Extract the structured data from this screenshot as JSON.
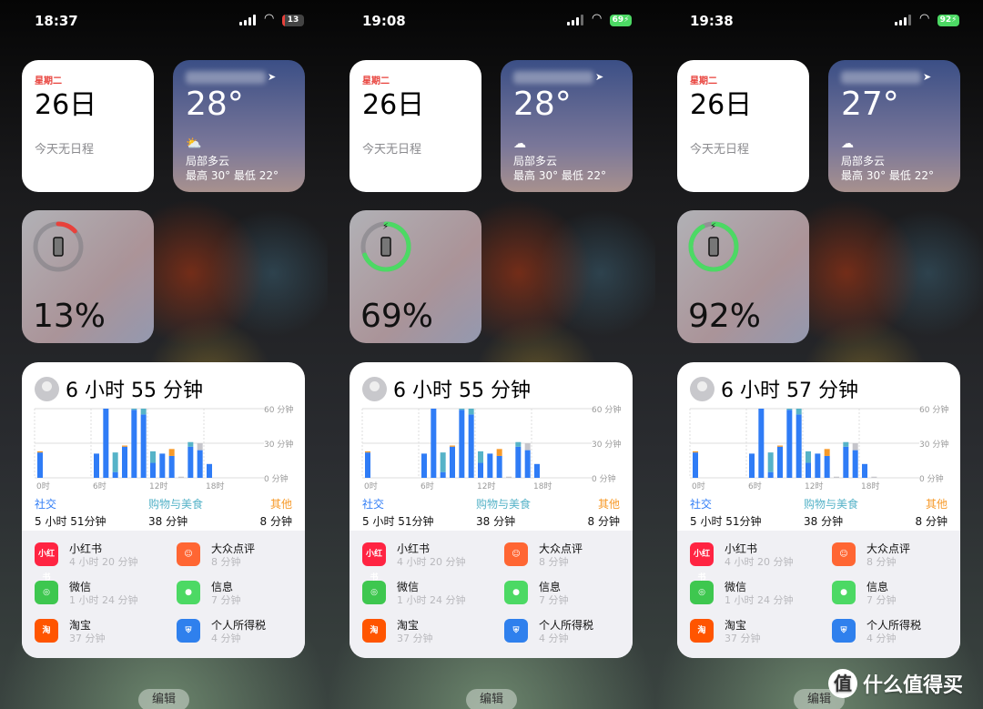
{
  "colors": {
    "social": "#2f7cf6",
    "shopping": "#56b3c8",
    "other": "#f79a2a",
    "gray": "#c5c5cb",
    "battery_low": "#e8413b",
    "battery_charging": "#4cd964"
  },
  "chart_axis": {
    "y_labels": [
      "60 分钟",
      "30 分钟",
      "0 分钟"
    ],
    "x_labels": [
      "0时",
      "6时",
      "12时",
      "18时"
    ],
    "ylim": [
      0,
      60
    ]
  },
  "panels": [
    {
      "status": {
        "time": "18:37",
        "battery": "13",
        "battery_charging": false
      },
      "calendar": {
        "weekday": "星期二",
        "day": "26日",
        "events": "今天无日程"
      },
      "weather": {
        "temp": "28°",
        "condition": "局部多云",
        "hilo": "最高 30° 最低 22°",
        "icon": "partly-sunny-icon"
      },
      "battery_widget": {
        "percent": "13%",
        "level": 0.13,
        "charging": false
      },
      "screen_time": {
        "total": "6 小时 55 分钟",
        "categories": [
          {
            "label": "社交",
            "value": "5 小时 51分钟"
          },
          {
            "label": "购物与美食",
            "value": "38 分钟"
          },
          {
            "label": "其他",
            "value": "8 分钟"
          }
        ],
        "chart_data": {
          "type": "bar",
          "stacked": true,
          "x": [
            0,
            1,
            2,
            3,
            4,
            5,
            6,
            7,
            8,
            9,
            10,
            11,
            12,
            13,
            14,
            15,
            16,
            17,
            18,
            19,
            20,
            21,
            22,
            23
          ],
          "series": [
            {
              "name": "社交",
              "values": [
                22,
                0,
                0,
                0,
                0,
                0,
                21,
                60,
                5,
                27,
                59,
                55,
                13,
                21,
                19,
                0,
                27,
                24,
                12,
                0,
                0,
                0,
                0,
                0
              ]
            },
            {
              "name": "购物与美食",
              "values": [
                0,
                0,
                0,
                0,
                0,
                0,
                0,
                0,
                17,
                0,
                1,
                5,
                10,
                0,
                0,
                0,
                4,
                0,
                0,
                0,
                0,
                0,
                0,
                0
              ]
            },
            {
              "name": "其他",
              "values": [
                1,
                0,
                0,
                0,
                0,
                0,
                0,
                0,
                0,
                1,
                0,
                0,
                0,
                0,
                6,
                0,
                0,
                0,
                0,
                0,
                0,
                0,
                0,
                0
              ]
            },
            {
              "values": [
                0,
                0,
                0,
                0,
                0,
                0,
                0,
                0,
                0,
                0,
                0,
                0,
                0,
                0,
                0,
                1,
                0,
                6,
                0,
                0,
                0,
                0,
                0,
                0
              ]
            }
          ]
        },
        "apps": [
          {
            "name": "小红书",
            "time": "4 小时 20 分钟",
            "icon": "xiaohongshu-icon"
          },
          {
            "name": "大众点评",
            "time": "8 分钟",
            "icon": "dianping-icon"
          },
          {
            "name": "微信",
            "time": "1 小时 24 分钟",
            "icon": "wechat-icon"
          },
          {
            "name": "信息",
            "time": "7 分钟",
            "icon": "messages-icon"
          },
          {
            "name": "淘宝",
            "time": "37 分钟",
            "icon": "taobao-icon"
          },
          {
            "name": "个人所得税",
            "time": "4 分钟",
            "icon": "tax-icon"
          }
        ]
      },
      "edit_label": "编辑"
    },
    {
      "status": {
        "time": "19:08",
        "battery": "69",
        "battery_charging": true
      },
      "calendar": {
        "weekday": "星期二",
        "day": "26日",
        "events": "今天无日程"
      },
      "weather": {
        "temp": "28°",
        "condition": "局部多云",
        "hilo": "最高 30° 最低 22°",
        "icon": "partly-cloudy-night-icon"
      },
      "battery_widget": {
        "percent": "69%",
        "level": 0.69,
        "charging": true
      },
      "screen_time": {
        "total": "6 小时 55 分钟",
        "categories": [
          {
            "label": "社交",
            "value": "5 小时 51分钟"
          },
          {
            "label": "购物与美食",
            "value": "38 分钟"
          },
          {
            "label": "其他",
            "value": "8 分钟"
          }
        ],
        "chart_data": {
          "type": "bar",
          "stacked": true,
          "x": [
            0,
            1,
            2,
            3,
            4,
            5,
            6,
            7,
            8,
            9,
            10,
            11,
            12,
            13,
            14,
            15,
            16,
            17,
            18,
            19,
            20,
            21,
            22,
            23
          ],
          "series": [
            {
              "name": "社交",
              "values": [
                22,
                0,
                0,
                0,
                0,
                0,
                21,
                60,
                5,
                27,
                59,
                55,
                13,
                21,
                19,
                0,
                27,
                24,
                12,
                0,
                0,
                0,
                0,
                0
              ]
            },
            {
              "name": "购物与美食",
              "values": [
                0,
                0,
                0,
                0,
                0,
                0,
                0,
                0,
                17,
                0,
                1,
                5,
                10,
                0,
                0,
                0,
                4,
                0,
                0,
                0,
                0,
                0,
                0,
                0
              ]
            },
            {
              "name": "其他",
              "values": [
                1,
                0,
                0,
                0,
                0,
                0,
                0,
                0,
                0,
                1,
                0,
                0,
                0,
                0,
                6,
                0,
                0,
                0,
                0,
                0,
                0,
                0,
                0,
                0
              ]
            },
            {
              "values": [
                0,
                0,
                0,
                0,
                0,
                0,
                0,
                0,
                0,
                0,
                0,
                0,
                0,
                0,
                0,
                1,
                0,
                6,
                0,
                0,
                0,
                0,
                0,
                0
              ]
            }
          ]
        },
        "apps": [
          {
            "name": "小红书",
            "time": "4 小时 20 分钟",
            "icon": "xiaohongshu-icon"
          },
          {
            "name": "大众点评",
            "time": "8 分钟",
            "icon": "dianping-icon"
          },
          {
            "name": "微信",
            "time": "1 小时 24 分钟",
            "icon": "wechat-icon"
          },
          {
            "name": "信息",
            "time": "7 分钟",
            "icon": "messages-icon"
          },
          {
            "name": "淘宝",
            "time": "37 分钟",
            "icon": "taobao-icon"
          },
          {
            "name": "个人所得税",
            "time": "4 分钟",
            "icon": "tax-icon"
          }
        ]
      },
      "edit_label": "编辑"
    },
    {
      "status": {
        "time": "19:38",
        "battery": "92",
        "battery_charging": true
      },
      "calendar": {
        "weekday": "星期二",
        "day": "26日",
        "events": "今天无日程"
      },
      "weather": {
        "temp": "27°",
        "condition": "局部多云",
        "hilo": "最高 30° 最低 22°",
        "icon": "partly-cloudy-night-icon"
      },
      "battery_widget": {
        "percent": "92%",
        "level": 0.92,
        "charging": true
      },
      "screen_time": {
        "total": "6 小时 57 分钟",
        "categories": [
          {
            "label": "社交",
            "value": "5 小时 51分钟"
          },
          {
            "label": "购物与美食",
            "value": "38 分钟"
          },
          {
            "label": "其他",
            "value": "8 分钟"
          }
        ],
        "chart_data": {
          "type": "bar",
          "stacked": true,
          "x": [
            0,
            1,
            2,
            3,
            4,
            5,
            6,
            7,
            8,
            9,
            10,
            11,
            12,
            13,
            14,
            15,
            16,
            17,
            18,
            19,
            20,
            21,
            22,
            23
          ],
          "series": [
            {
              "name": "社交",
              "values": [
                22,
                0,
                0,
                0,
                0,
                0,
                21,
                60,
                5,
                27,
                59,
                55,
                13,
                21,
                19,
                0,
                27,
                24,
                12,
                0,
                0,
                0,
                0,
                0
              ]
            },
            {
              "name": "购物与美食",
              "values": [
                0,
                0,
                0,
                0,
                0,
                0,
                0,
                0,
                17,
                0,
                1,
                5,
                10,
                0,
                0,
                0,
                4,
                0,
                0,
                0,
                0,
                0,
                0,
                0
              ]
            },
            {
              "name": "其他",
              "values": [
                1,
                0,
                0,
                0,
                0,
                0,
                0,
                0,
                0,
                1,
                0,
                0,
                0,
                0,
                6,
                0,
                0,
                0,
                0,
                0,
                0,
                0,
                0,
                0
              ]
            },
            {
              "values": [
                0,
                0,
                0,
                0,
                0,
                0,
                0,
                0,
                0,
                0,
                0,
                0,
                0,
                0,
                0,
                1,
                0,
                6,
                0,
                1,
                0,
                0,
                0,
                0
              ]
            }
          ]
        },
        "apps": [
          {
            "name": "小红书",
            "time": "4 小时 20 分钟",
            "icon": "xiaohongshu-icon"
          },
          {
            "name": "大众点评",
            "time": "8 分钟",
            "icon": "dianping-icon"
          },
          {
            "name": "微信",
            "time": "1 小时 24 分钟",
            "icon": "wechat-icon"
          },
          {
            "name": "信息",
            "time": "7 分钟",
            "icon": "messages-icon"
          },
          {
            "name": "淘宝",
            "time": "37 分钟",
            "icon": "taobao-icon"
          },
          {
            "name": "个人所得税",
            "time": "4 分钟",
            "icon": "tax-icon"
          }
        ]
      },
      "edit_label": "编辑"
    }
  ],
  "watermark": {
    "logo_text": "值",
    "text": "什么值得买"
  }
}
